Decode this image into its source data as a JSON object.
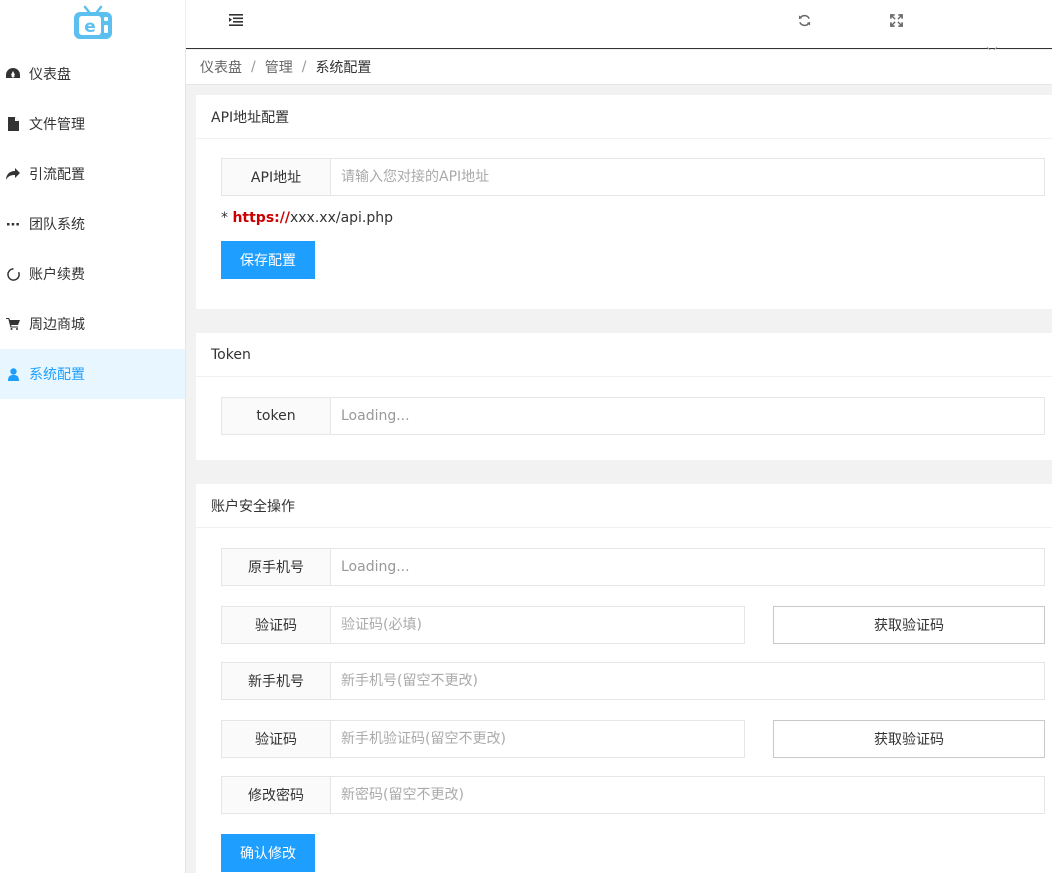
{
  "colors": {
    "accent": "#1e9fff",
    "hint_red": "#cc0000",
    "active_bg": "#e8f7ff"
  },
  "header": {
    "menu_icon": "indent-menu-icon",
    "refresh_icon": "refresh-icon",
    "fullscreen_icon": "fullscreen-icon",
    "chevron_icon": "chevron-down-icon"
  },
  "logo": {
    "icon": "tv-e-logo"
  },
  "sidebar": {
    "items": [
      {
        "label": "仪表盘",
        "icon": "dashboard-icon",
        "active": false
      },
      {
        "label": "文件管理",
        "icon": "file-icon",
        "active": false
      },
      {
        "label": "引流配置",
        "icon": "share-icon",
        "active": false
      },
      {
        "label": "团队系统",
        "icon": "dots-icon",
        "active": false
      },
      {
        "label": "账户续费",
        "icon": "loop-icon",
        "active": false
      },
      {
        "label": "周边商城",
        "icon": "cart-icon",
        "active": false
      },
      {
        "label": "系统配置",
        "icon": "user-icon",
        "active": true
      }
    ]
  },
  "breadcrumb": {
    "items": [
      "仪表盘",
      "管理",
      "系统配置"
    ],
    "separator": "/"
  },
  "api_card": {
    "title": "API地址配置",
    "field_label": "API地址",
    "field_placeholder": "请输入您对接的API地址",
    "hint_star": "* ",
    "hint_scheme": "https://",
    "hint_rest": "xxx.xx/api.php",
    "save_label": "保存配置"
  },
  "token_card": {
    "title": "Token",
    "field_label": "token",
    "field_value": "Loading..."
  },
  "security_card": {
    "title": "账户安全操作",
    "orig_phone_label": "原手机号",
    "orig_phone_value": "Loading...",
    "code1_label": "验证码",
    "code1_placeholder": "验证码(必填)",
    "get_code1_label": "获取验证码",
    "new_phone_label": "新手机号",
    "new_phone_placeholder": "新手机号(留空不更改)",
    "code2_label": "验证码",
    "code2_placeholder": "新手机验证码(留空不更改)",
    "get_code2_label": "获取验证码",
    "password_label": "修改密码",
    "password_placeholder": "新密码(留空不更改)",
    "confirm_label": "确认修改"
  }
}
